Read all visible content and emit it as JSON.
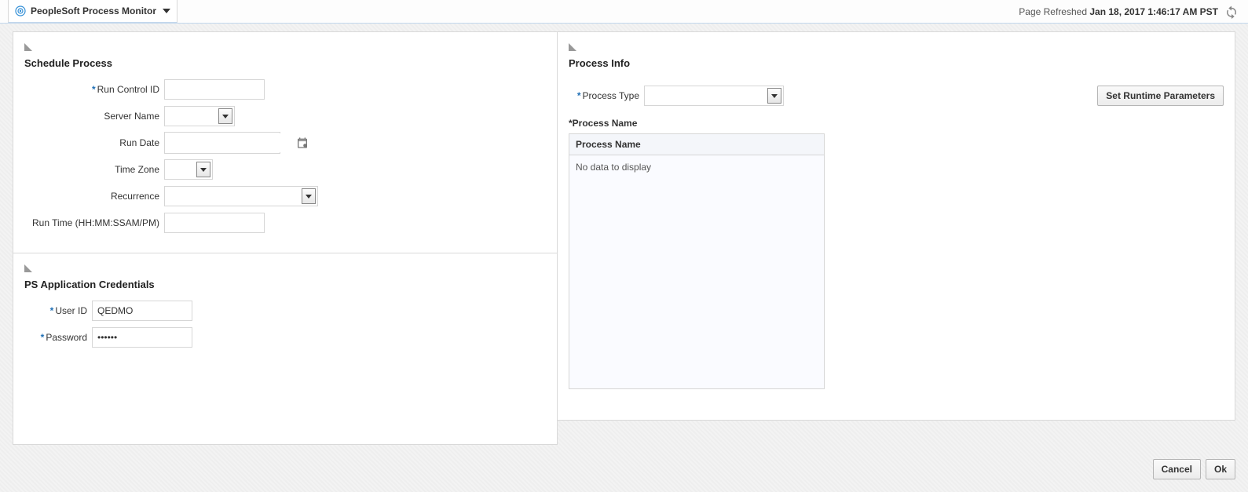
{
  "header": {
    "title": "PeopleSoft Process Monitor",
    "refreshed_label": "Page Refreshed",
    "refreshed_ts": "Jan 18, 2017 1:46:17 AM PST"
  },
  "schedule": {
    "heading": "Schedule Process",
    "labels": {
      "run_control_id": "Run Control ID",
      "server_name": "Server Name",
      "run_date": "Run Date",
      "time_zone": "Time Zone",
      "recurrence": "Recurrence",
      "run_time": "Run Time (HH:MM:SSAM/PM)"
    },
    "values": {
      "run_control_id": "",
      "server_name": "",
      "run_date": "",
      "time_zone": "",
      "recurrence": "",
      "run_time": ""
    }
  },
  "credentials": {
    "heading": "PS Application Credentials",
    "labels": {
      "user_id": "User ID",
      "password": "Password"
    },
    "values": {
      "user_id": "QEDMO",
      "password": "••••••"
    }
  },
  "process_info": {
    "heading": "Process Info",
    "labels": {
      "process_type": "Process Type",
      "process_name_section": "*Process Name",
      "process_name_col": "Process Name"
    },
    "values": {
      "process_type": ""
    },
    "runtime_button": "Set Runtime Parameters",
    "empty_text": "No data to display"
  },
  "footer": {
    "cancel": "Cancel",
    "ok": "Ok"
  }
}
